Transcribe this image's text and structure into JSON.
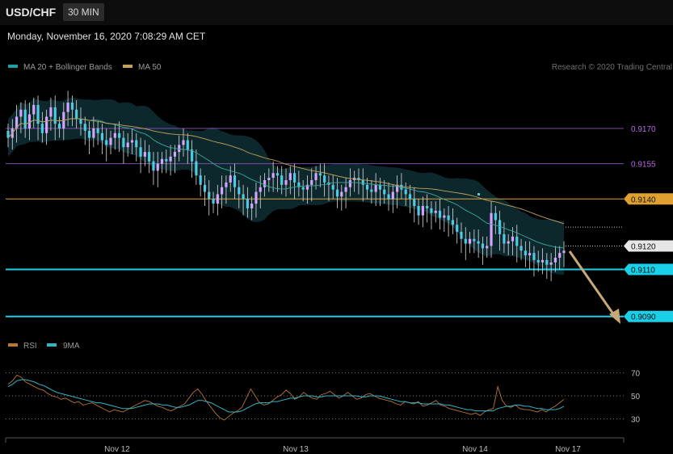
{
  "header": {
    "symbol": "USD/CHF",
    "timeframe": "30 MIN",
    "datetime": "Monday, November 16, 2020 7:08:29 AM CET"
  },
  "legend": {
    "ma20_label": "MA 20 + Bollinger Bands",
    "ma50_label": "MA 50",
    "credit": "Research © 2020 Trading Central",
    "rsi_label": "RSI",
    "rsi_ma_label": "9MA"
  },
  "colors": {
    "background": "#000000",
    "bull_candle": "#d6a4ff",
    "bear_candle": "#4ecbe4",
    "wick": "#dddddd",
    "bollinger_band": "#0e2a2f",
    "ma20": "#3aa7a0",
    "ma50": "#c2a25a",
    "resistance_purple": "#7a4da6",
    "resistance_orange": "#e0a030",
    "support_cyan": "#1ad0e8",
    "forecast_arrow": "#c8a878",
    "rsi": "#b8763a",
    "rsi_ma": "#2fb6c8"
  },
  "chart_data": [
    {
      "type": "candlestick",
      "x_tick_labels": [
        "Nov 12",
        "Nov 13",
        "Nov 14",
        "Nov 17"
      ],
      "ylim": [
        0.9082,
        0.9192
      ],
      "price_levels": [
        {
          "value": 0.917,
          "label": "0.9170",
          "style": "purple-line"
        },
        {
          "value": 0.9155,
          "label": "0.9155",
          "style": "purple-line"
        },
        {
          "value": 0.914,
          "label": "0.9140",
          "style": "orange-badge"
        },
        {
          "value": 0.912,
          "label": "0.9120",
          "style": "grey-badge"
        },
        {
          "value": 0.911,
          "label": "0.9110",
          "style": "cyan-badge"
        },
        {
          "value": 0.909,
          "label": "0.9090",
          "style": "cyan-badge"
        }
      ],
      "close": [
        0.9166,
        0.917,
        0.9175,
        0.9178,
        0.917,
        0.9176,
        0.918,
        0.9172,
        0.9168,
        0.9175,
        0.9179,
        0.9172,
        0.917,
        0.9177,
        0.9181,
        0.9178,
        0.9174,
        0.9172,
        0.9169,
        0.9166,
        0.917,
        0.9168,
        0.9165,
        0.9163,
        0.9166,
        0.9168,
        0.9166,
        0.9162,
        0.9164,
        0.9165,
        0.9162,
        0.9158,
        0.916,
        0.9156,
        0.9152,
        0.9155,
        0.9157,
        0.9156,
        0.9158,
        0.916,
        0.9163,
        0.9165,
        0.9161,
        0.9156,
        0.915,
        0.9146,
        0.9143,
        0.914,
        0.9138,
        0.9142,
        0.9145,
        0.9147,
        0.915,
        0.9145,
        0.9142,
        0.914,
        0.9136,
        0.9138,
        0.9143,
        0.9145,
        0.9148,
        0.9149,
        0.9151,
        0.915,
        0.9146,
        0.9148,
        0.9151,
        0.9147,
        0.9145,
        0.9144,
        0.9146,
        0.9148,
        0.9151,
        0.915,
        0.9147,
        0.9146,
        0.9144,
        0.9141,
        0.9143,
        0.9145,
        0.9148,
        0.9149,
        0.9148,
        0.9146,
        0.9144,
        0.9143,
        0.9146,
        0.9144,
        0.9142,
        0.914,
        0.9143,
        0.9146,
        0.9144,
        0.9142,
        0.914,
        0.9137,
        0.9133,
        0.9137,
        0.9136,
        0.9134,
        0.9135,
        0.9132,
        0.9133,
        0.9131,
        0.9129,
        0.9126,
        0.9123,
        0.9121,
        0.9123,
        0.9122,
        0.9121,
        0.9119,
        0.912,
        0.9134,
        0.9131,
        0.9125,
        0.9121,
        0.9122,
        0.9124,
        0.912,
        0.9118,
        0.9116,
        0.9117,
        0.9114,
        0.9113,
        0.9114,
        0.9112,
        0.9113,
        0.9115,
        0.9117,
        0.9118
      ],
      "rsi": {
        "ylim": [
          22,
          78
        ],
        "levels": [
          70,
          50,
          30
        ],
        "rsi_values": [
          60,
          63,
          68,
          66,
          62,
          60,
          58,
          56,
          55,
          52,
          50,
          49,
          47,
          48,
          46,
          44,
          45,
          42,
          43,
          44,
          42,
          40,
          38,
          36,
          38,
          37,
          36,
          38,
          40,
          42,
          44,
          46,
          45,
          43,
          41,
          40,
          38,
          37,
          39,
          41,
          43,
          48,
          53,
          56,
          51,
          45,
          40,
          35,
          31,
          29,
          32,
          35,
          37,
          40,
          48,
          56,
          50,
          44,
          42,
          43,
          46,
          49,
          51,
          55,
          52,
          47,
          49,
          53,
          50,
          48,
          47,
          51,
          52,
          54,
          51,
          48,
          50,
          53,
          50,
          47,
          48,
          51,
          52,
          50,
          48,
          47,
          46,
          45,
          43,
          42,
          45,
          44,
          43,
          45,
          41,
          42,
          44,
          46,
          42,
          41,
          39,
          38,
          37,
          36,
          35,
          34,
          35,
          33,
          36,
          38,
          39,
          58,
          46,
          41,
          40,
          42,
          39,
          38,
          38,
          37,
          36,
          38,
          36,
          39,
          41,
          44,
          47
        ],
        "ma_values": [
          58,
          60,
          63,
          64,
          64,
          63,
          62,
          60,
          59,
          57,
          55,
          53,
          52,
          51,
          50,
          49,
          48,
          47,
          46,
          45,
          44,
          44,
          43,
          42,
          41,
          40,
          39,
          39,
          39,
          40,
          41,
          42,
          43,
          43,
          43,
          42,
          42,
          41,
          40,
          40,
          41,
          42,
          44,
          46,
          46,
          45,
          44,
          42,
          40,
          38,
          36,
          36,
          36,
          37,
          39,
          41,
          43,
          44,
          44,
          44,
          45,
          45,
          46,
          47,
          48,
          48,
          49,
          50,
          50,
          50,
          49,
          49,
          50,
          50,
          50,
          50,
          50,
          50,
          50,
          50,
          49,
          49,
          50,
          50,
          50,
          49,
          48,
          47,
          46,
          45,
          45,
          44,
          44,
          44,
          43,
          43,
          43,
          43,
          43,
          42,
          42,
          41,
          40,
          39,
          38,
          38,
          37,
          37,
          37,
          37,
          37,
          39,
          40,
          41,
          41,
          42,
          42,
          41,
          41,
          40,
          39,
          39,
          38,
          38,
          38,
          39,
          41
        ]
      }
    }
  ]
}
